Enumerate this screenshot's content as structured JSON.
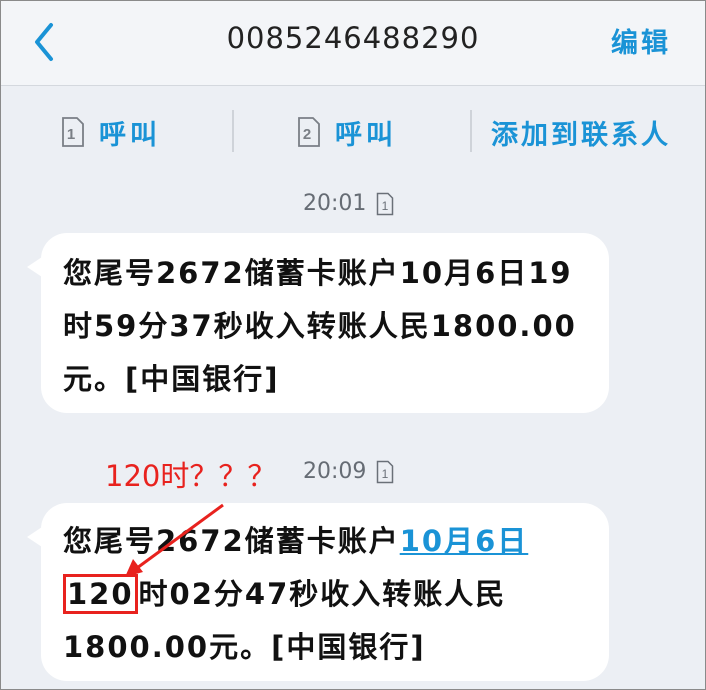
{
  "header": {
    "title": "0085246488290",
    "edit_label": "编辑",
    "back_icon": "chevron-left-icon"
  },
  "actions": {
    "call1": {
      "sim": "1",
      "label": "呼叫"
    },
    "call2": {
      "sim": "2",
      "label": "呼叫"
    },
    "add_contact_label": "添加到联系人"
  },
  "messages": [
    {
      "time": "20:01",
      "sim": "1",
      "lines": [
        "您尾号2672储蓄卡账户10月6日19",
        "时59分37秒收入转账人民1800.00",
        "元。[中国银行]"
      ]
    },
    {
      "time": "20:09",
      "sim": "1",
      "line1_prefix": "您尾号2672储蓄卡账户",
      "line1_link": "10月6日",
      "line2_highlight": "120",
      "line2_rest": "时02分47秒收入转账人民",
      "line3": "1800.00元。[中国银行]"
    }
  ],
  "annotation": {
    "text": "120时？？？",
    "color": "#e8221e"
  },
  "colors": {
    "accent": "#1a93d6",
    "background": "#eceff4",
    "bubble": "#ffffff"
  }
}
